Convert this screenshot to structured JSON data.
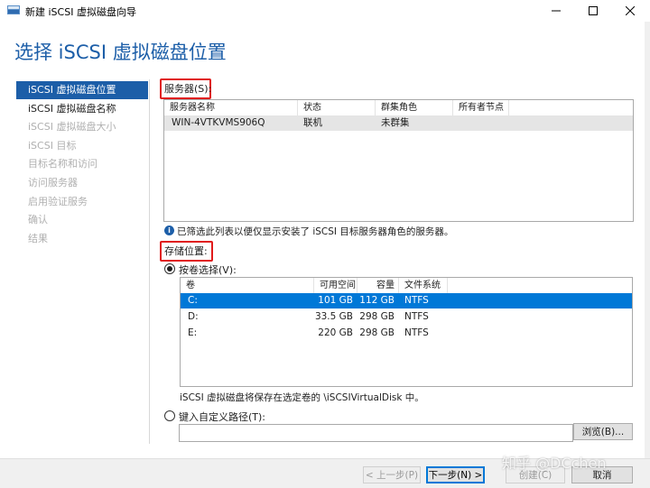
{
  "window": {
    "title": "新建 iSCSI 虚拟磁盘向导",
    "controls": [
      "minimize-icon",
      "maximize-icon",
      "close-icon"
    ]
  },
  "page_heading": "选择 iSCSI 虚拟磁盘位置",
  "nav": {
    "items": [
      {
        "label": "iSCSI 虚拟磁盘位置",
        "state": "current"
      },
      {
        "label": "iSCSI 虚拟磁盘名称",
        "state": "enabled"
      },
      {
        "label": "iSCSI 虚拟磁盘大小",
        "state": "disabled"
      },
      {
        "label": "iSCSI 目标",
        "state": "disabled"
      },
      {
        "label": "目标名称和访问",
        "state": "disabled"
      },
      {
        "label": "访问服务器",
        "state": "disabled"
      },
      {
        "label": "启用验证服务",
        "state": "disabled"
      },
      {
        "label": "确认",
        "state": "disabled"
      },
      {
        "label": "结果",
        "state": "disabled"
      }
    ]
  },
  "server_section": {
    "label": "服务器(S):",
    "columns": [
      "服务器名称",
      "状态",
      "群集角色",
      "所有者节点"
    ],
    "rows": [
      {
        "name": "WIN-4VTKVMS906Q",
        "status": "联机",
        "cluster_role": "未群集",
        "owner": ""
      }
    ],
    "info_text": "已筛选此列表以便仅显示安装了 iSCSI 目标服务器角色的服务器。"
  },
  "storage_section": {
    "label": "存储位置:",
    "by_volume_label": "按卷选择(V):",
    "by_volume_selected": true,
    "columns": [
      "卷",
      "可用空间",
      "容量",
      "文件系统"
    ],
    "volumes": [
      {
        "volume": "C:",
        "free": "101 GB",
        "capacity": "112 GB",
        "fs": "NTFS",
        "selected": true
      },
      {
        "volume": "D:",
        "free": "33.5 GB",
        "capacity": "298 GB",
        "fs": "NTFS",
        "selected": false
      },
      {
        "volume": "E:",
        "free": "220 GB",
        "capacity": "298 GB",
        "fs": "NTFS",
        "selected": false
      }
    ],
    "note": "iSCSI 虚拟磁盘将保存在选定卷的 \\iSCSIVirtualDisk 中。",
    "custom_path_label": "键入自定义路径(T):",
    "custom_path_selected": false,
    "custom_path_value": "",
    "browse_label": "浏览(B)..."
  },
  "footer": {
    "prev_label": "< 上一步(P)",
    "next_label": "下一步(N) >",
    "create_label": "创建(C)",
    "cancel_label": "取消"
  },
  "watermark": "知乎 @DCchen",
  "colors": {
    "accent": "#1c5ea8",
    "selection": "#0078d7",
    "highlight_box": "#e01b1b"
  }
}
